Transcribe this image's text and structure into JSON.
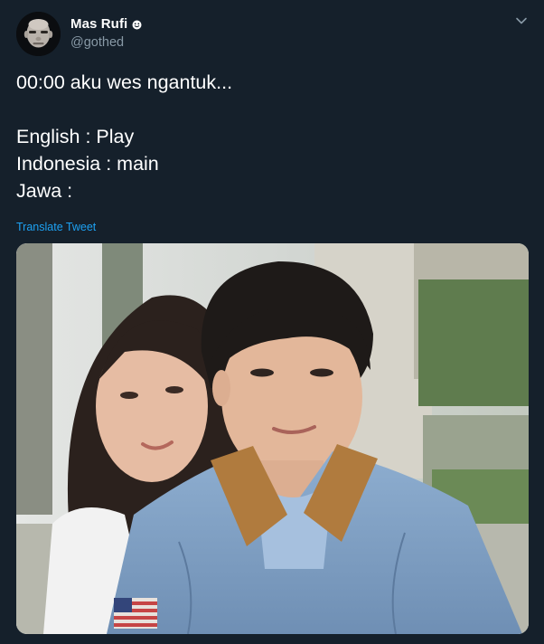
{
  "user": {
    "display_name": "Mas Rufi",
    "handle": "@gothed",
    "avatar_icon": "avatar-photo",
    "badge_icon": "smiley-icon"
  },
  "menu": {
    "icon": "chevron-down-icon"
  },
  "tweet": {
    "lines": [
      "00:00 aku wes ngantuk...",
      "",
      "English : Play",
      "Indonesia : main",
      "Jawa :"
    ]
  },
  "translate_label": "Translate Tweet",
  "media": {
    "type": "photo",
    "subject": "two people outdoors, boy in denim jacket in front"
  },
  "colors": {
    "background": "#15202b",
    "text": "#ffffff",
    "secondary_text": "#8899a6",
    "link": "#1da1f2"
  }
}
